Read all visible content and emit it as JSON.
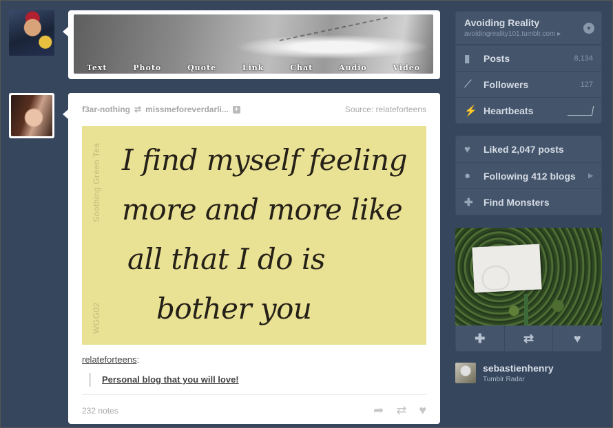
{
  "post_types": [
    "Text",
    "Photo",
    "Quote",
    "Link",
    "Chat",
    "Audio",
    "Video"
  ],
  "post": {
    "author": "f3ar-nothing",
    "reblogged_from": "missmeforeverdarli...",
    "source": "Source: relateforteens",
    "image_side_text_1": "Soothing Green Tea",
    "image_side_text_2": "WGG02",
    "image_lines": [
      "I find myself feeling",
      "more  and  more  like",
      "all that  I  do  is",
      "bother  you"
    ],
    "credit_link": "relateforteens",
    "credit_suffix": ":",
    "quote": "Personal blog that you will love!",
    "notes": "232 notes"
  },
  "sidebar": {
    "blog_name": "Avoiding Reality",
    "blog_url": "avoidingreality101.tumblr.com",
    "url_chevron": "▸",
    "stats": [
      {
        "label": "Posts",
        "count": "8,134"
      },
      {
        "label": "Followers",
        "count": "127"
      },
      {
        "label": "Heartbeats",
        "count": ""
      }
    ],
    "links": [
      {
        "label": "Liked 2,047 posts"
      },
      {
        "label": "Following 412 blogs"
      },
      {
        "label": "Find Monsters"
      }
    ]
  },
  "radar": {
    "user": "sebastienhenry",
    "subtitle": "Tumblr Radar"
  }
}
